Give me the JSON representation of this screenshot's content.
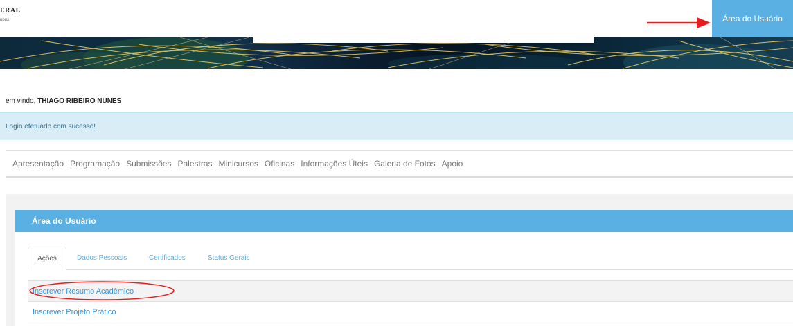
{
  "header": {
    "logo_title": "ERAL",
    "logo_sub": "npus",
    "user_area_button": "Área do Usuário"
  },
  "welcome": {
    "prefix": "em vindo, ",
    "user_name": "THIAGO RIBEIRO NUNES"
  },
  "alert": {
    "message": "Login efetuado com sucesso!"
  },
  "nav": {
    "items": [
      "Apresentação",
      "Programação",
      "Submissões",
      "Palestras",
      "Minicursos",
      "Oficinas",
      "Informações Úteis",
      "Galeria de Fotos",
      "Apoio"
    ]
  },
  "panel": {
    "title": "Área do Usuário",
    "tabs": [
      "Ações",
      "Dados Pessoais",
      "Certificados",
      "Status Gerais"
    ],
    "actions": [
      "Inscrever Resumo Acadêmico",
      "Inscrever Projeto Prático"
    ]
  },
  "colors": {
    "accent": "#5aafe3",
    "link": "#3a95d6",
    "alert_bg": "#d9edf7",
    "alert_text": "#31708f",
    "annotation_red": "#e41e1e"
  }
}
